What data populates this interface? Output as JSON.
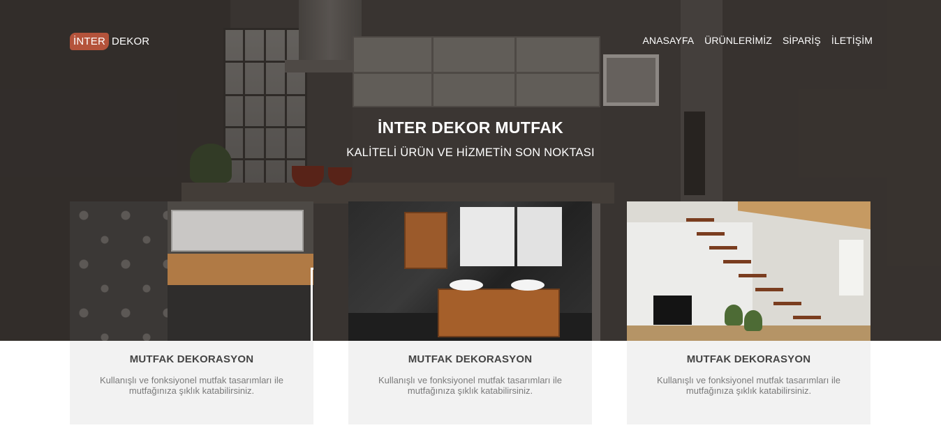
{
  "brand": {
    "logo_badge": "İNTER",
    "logo_text": "DEKOR",
    "accent_color": "#b4533b"
  },
  "nav": {
    "items": [
      "ANASAYFA",
      "ÜRÜNLERİMİZ",
      "SİPARİŞ",
      "İLETİŞİM"
    ]
  },
  "hero": {
    "title": "İNTER DEKOR MUTFAK",
    "subtitle": "KALİTELİ ÜRÜN VE HİZMETİN SON NOKTASI"
  },
  "cards": [
    {
      "title": "MUTFAK DEKORASYON",
      "text": "Kullanışlı ve fonksiyonel mutfak tasarımları ile mutfağınıza şıklık katabilirsiniz."
    },
    {
      "title": "MUTFAK DEKORASYON",
      "text": "Kullanışlı ve fonksiyonel mutfak tasarımları ile mutfağınıza şıklık katabilirsiniz."
    },
    {
      "title": "MUTFAK DEKORASYON",
      "text": "Kullanışlı ve fonksiyonel mutfak tasarımları ile mutfağınıza şıklık katabilirsiniz."
    }
  ]
}
